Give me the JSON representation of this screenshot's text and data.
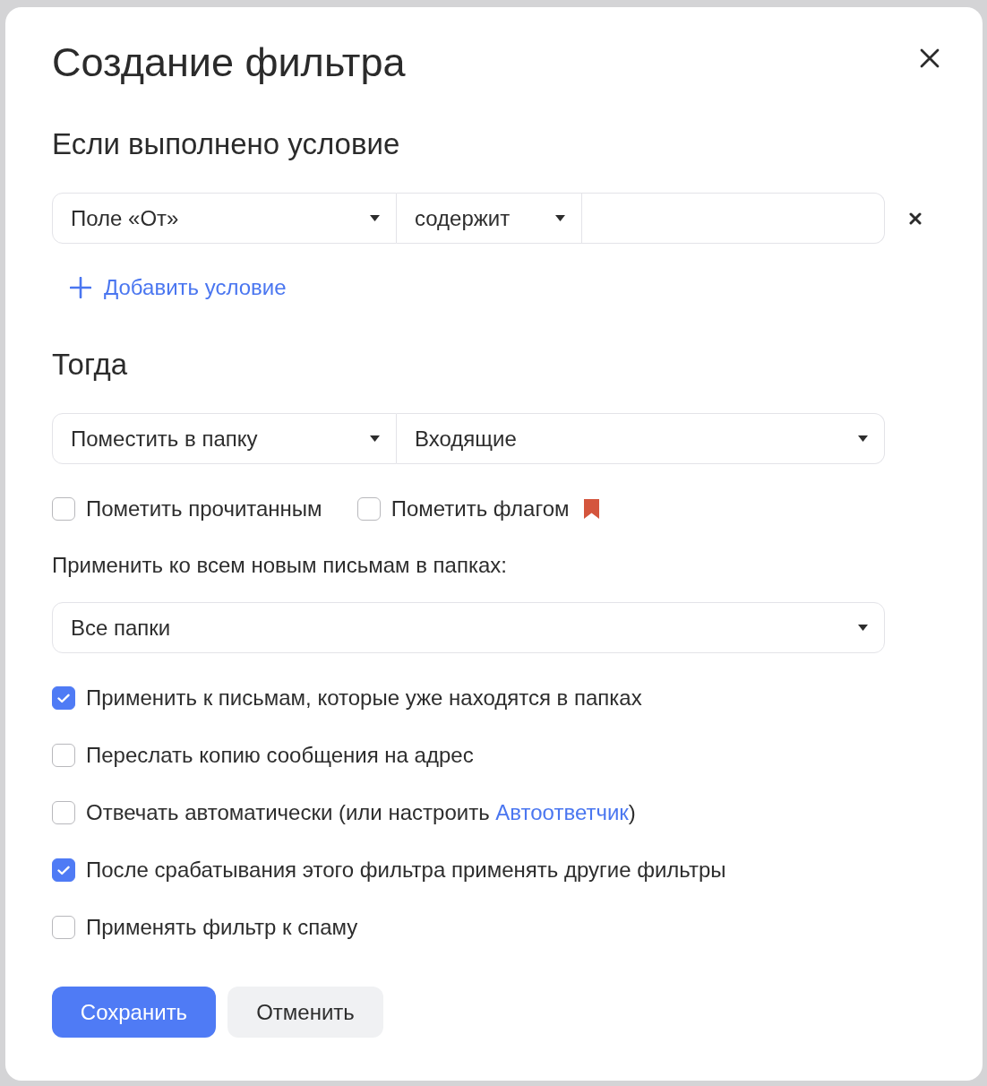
{
  "dialog": {
    "title": "Создание фильтра"
  },
  "conditions_section": {
    "heading": "Если выполнено условие",
    "conditions": [
      {
        "field": "Поле «От»",
        "operator": "содержит"
      }
    ],
    "add_condition": "Добавить условие"
  },
  "actions_section": {
    "heading": "Тогда",
    "action": "Поместить в папку",
    "folder": "Входящие"
  },
  "mark_options": [
    {
      "label": "Пометить прочитанным",
      "checked": false,
      "kind": "plain"
    },
    {
      "label": "Пометить флагом",
      "checked": false,
      "kind": "flag"
    }
  ],
  "apply_scope": {
    "label": "Применить ко всем новым письмам в папках:",
    "folders": "Все папки"
  },
  "options": [
    {
      "kind": "text",
      "label": "Применить к письмам, которые уже находятся в папках",
      "checked": true
    },
    {
      "kind": "text",
      "label": "Переслать копию сообщения на адрес",
      "checked": false
    },
    {
      "kind": "link",
      "label": "Отвечать автоматически (или настроить ",
      "link": "Автоответчик",
      "label_after": ")",
      "checked": false
    },
    {
      "kind": "text",
      "label": "После срабатывания этого фильтра применять другие фильтры",
      "checked": true
    },
    {
      "kind": "text",
      "label": "Применять фильтр к спаму",
      "checked": false
    }
  ],
  "buttons": [
    {
      "label": "Сохранить",
      "kind": "primary"
    },
    {
      "label": "Отменить",
      "kind": "secondary"
    }
  ]
}
